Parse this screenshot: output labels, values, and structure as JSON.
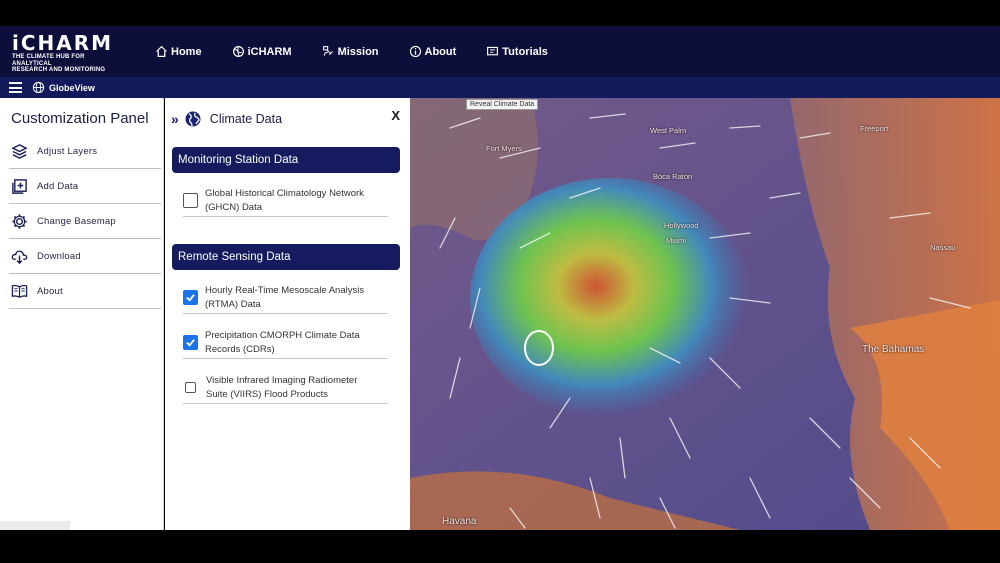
{
  "logo": {
    "title": "iCHARM",
    "subtitle_1": "THE CLIMATE HUB FOR ANALYTICAL",
    "subtitle_2": "RESEARCH AND MONITORING"
  },
  "nav": {
    "home": "Home",
    "icharm": "iCHARM",
    "mission": "Mission",
    "about": "About",
    "tutorials": "Tutorials"
  },
  "subbar": {
    "globeview": "GlobeView"
  },
  "customization": {
    "title": "Customization Panel",
    "items": [
      {
        "label": "Adjust Layers",
        "icon": "layers-icon"
      },
      {
        "label": "Add Data",
        "icon": "add-data-icon"
      },
      {
        "label": "Change Basemap",
        "icon": "gear-icon"
      },
      {
        "label": "Download",
        "icon": "cloud-download-icon"
      },
      {
        "label": "About",
        "icon": "book-icon"
      }
    ]
  },
  "climate": {
    "title": "Climate Data",
    "close": "X",
    "monitoring": {
      "header": "Monitoring Station Data",
      "items": [
        {
          "label_1": "Global Historical Climatology Network",
          "label_2": "(GHCN) Data",
          "checked": false
        }
      ]
    },
    "remote": {
      "header": "Remote Sensing Data",
      "items": [
        {
          "label_1": "Hourly Real-Time Mesoscale Analysis",
          "label_2": "(RTMA) Data",
          "checked": true
        },
        {
          "label_1": "Precipitation CMORPH Climate Data",
          "label_2": "Records (CDRs)",
          "checked": true
        },
        {
          "label_1": "Visible Infrared Imaging Radiometer",
          "label_2": "Suite (VIIRS) Flood Products",
          "checked": false
        }
      ]
    }
  },
  "map": {
    "tooltip": "Reveal Climate Data",
    "places": {
      "fort_myers": "Fort Myers",
      "west_palm": "West Palm",
      "boca_raton": "Boca Raton",
      "hollywood": "Hollywood",
      "miami": "Miami",
      "the_bahamas": "The Bahamas",
      "havana": "Havana",
      "freeport": "Freeport",
      "nassau": "Nassau"
    }
  },
  "colors": {
    "nav_bg": "#0d0e3a",
    "subbar_bg": "#121a5c",
    "section_bg": "#151b5e",
    "checkbox_blue": "#1a73e8"
  }
}
